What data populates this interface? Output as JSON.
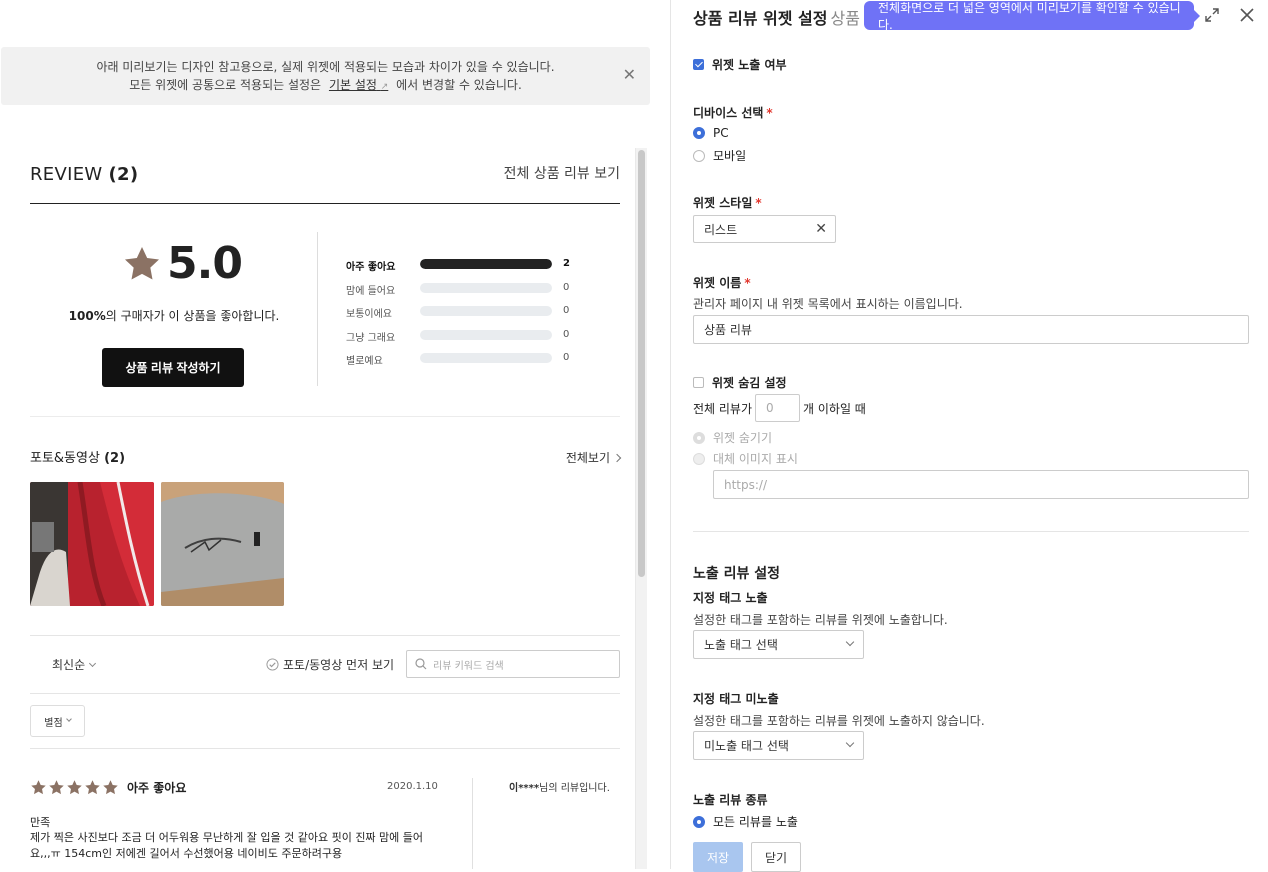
{
  "notice": {
    "line1": "아래 미리보기는 디자인 참고용으로, 실제 위젯에 적용되는 모습과 차이가 있을 수 있습니다.",
    "line2_prefix": "모든 위젯에 공통으로 적용되는 설정은",
    "link": "기본 설정",
    "line2_suffix": "에서 변경할 수 있습니다."
  },
  "review": {
    "title": "REVIEW",
    "count": "(2)",
    "all_link": "전체 상품 리뷰 보기",
    "score": "5.0",
    "percent": "100%",
    "percent_text": "의 구매자가 이 상품을 좋아합니다.",
    "write_button": "상품 리뷰 작성하기",
    "distribution": [
      {
        "label": "아주 좋아요",
        "count": "2",
        "fraction": 1.0
      },
      {
        "label": "맘에 들어요",
        "count": "0",
        "fraction": 0
      },
      {
        "label": "보통이에요",
        "count": "0",
        "fraction": 0
      },
      {
        "label": "그냥 그래요",
        "count": "0",
        "fraction": 0
      },
      {
        "label": "별로예요",
        "count": "0",
        "fraction": 0
      }
    ],
    "media_title": "포토&동영상",
    "media_count": "(2)",
    "media_all": "전체보기",
    "sort": "최신순",
    "photo_first": "포토/동영상 먼저 보기",
    "search_placeholder": "리뷰 키워드 검색",
    "star_filter": "별점",
    "item": {
      "rating_label": "아주 좋아요",
      "date": "2020.1.10",
      "user": "이****",
      "user_suffix": "님의 리뷰입니다.",
      "summary": "만족",
      "body": "제가 찍은 사진보다 조금 더 어두워용 무난하게 잘 입을 것 같아요 핏이 진짜 맘에 들어요,,,ㅠ 154cm인 저에겐 길어서 수선했어용 네이비도 주문하려구용"
    }
  },
  "panel": {
    "title": "상품 리뷰 위젯 설정",
    "title_sub": "상품",
    "tooltip": "전체화면으로 더 넓은 영역에서 미리보기를 확인할 수 있습니다.",
    "widget_visible": "위젯 노출 여부",
    "device_label": "디바이스 선택",
    "device_pc": "PC",
    "device_mobile": "모바일",
    "style_label": "위젯 스타일",
    "style_value": "리스트",
    "name_label": "위젯 이름",
    "name_desc": "관리자 페이지 내 위젯 목록에서 표시하는 이름입니다.",
    "name_value": "상품 리뷰",
    "hide_label": "위젯 숨김 설정",
    "hide_prefix": "전체 리뷰가",
    "hide_count": "0",
    "hide_suffix": "개 이하일 때",
    "hide_option1": "위젯 숨기기",
    "hide_option2": "대체 이미지 표시",
    "url_placeholder": "https://",
    "section_title": "노출 리뷰 설정",
    "tag_show_label": "지정 태그 노출",
    "tag_show_desc": "설정한 태그를 포함하는 리뷰를 위젯에 노출합니다.",
    "tag_show_select": "노출 태그 선택",
    "tag_hide_label": "지정 태그 미노출",
    "tag_hide_desc": "설정한 태그를 포함하는 리뷰를 위젯에 노출하지 않습니다.",
    "tag_hide_select": "미노출 태그 선택",
    "type_label": "노출 리뷰 종류",
    "type_all": "모든 리뷰를 노출",
    "save": "저장",
    "close": "닫기"
  },
  "colors": {
    "accent": "#3d6fd9",
    "tooltip": "#6f72f6",
    "star": "#8b7264",
    "required": "#e2372e"
  }
}
